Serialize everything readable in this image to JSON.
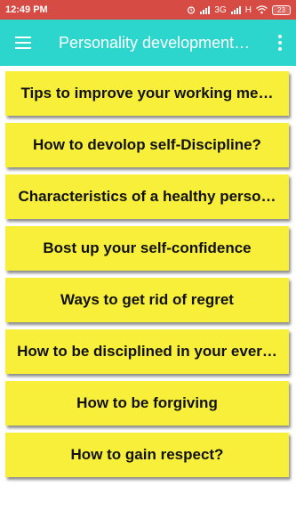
{
  "status_bar": {
    "time": "12:49 PM",
    "network": "3G",
    "carrier_mark": "H",
    "battery": "23",
    "icons": [
      "alarm-icon",
      "signal-icon",
      "signal-icon",
      "wifi-icon",
      "battery-icon"
    ]
  },
  "app_bar": {
    "title": "Personality development…",
    "menu_icon": "hamburger-icon",
    "overflow_icon": "more-vert-icon"
  },
  "topics": [
    "Tips to improve your working me…",
    "How to devolop self-Discipline?",
    "Characteristics of a healthy perso…",
    "Bost up your self-confidence",
    "Ways to get rid of regret",
    "How to be disciplined in your ever…",
    "How to be forgiving",
    "How to gain respect?"
  ],
  "colors": {
    "status_bar": "#d64b43",
    "app_bar": "#2dd6cc",
    "card": "#f8ef3a"
  }
}
